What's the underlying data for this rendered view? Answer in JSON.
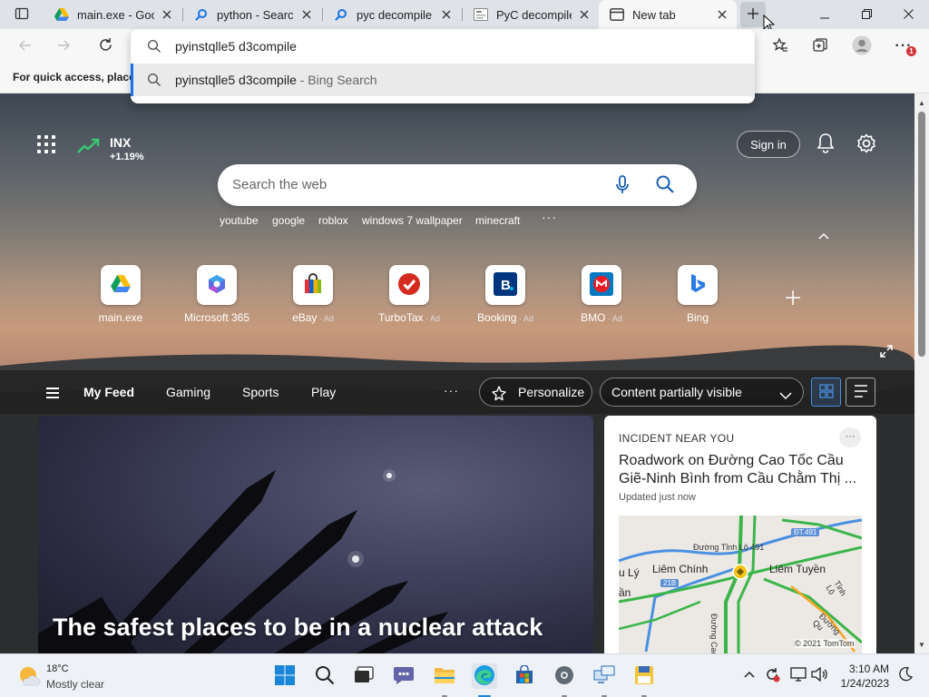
{
  "tabs": [
    {
      "title": "main.exe - Goog",
      "icon": "google-drive-icon"
    },
    {
      "title": "python - Search",
      "icon": "search-icon"
    },
    {
      "title": "pyc decompile o",
      "icon": "search-icon"
    },
    {
      "title": "PyC decompile",
      "icon": "page-icon"
    },
    {
      "title": "New tab",
      "icon": "newtab-icon"
    }
  ],
  "omnibox": {
    "value": "pyinstqlle5 d3compile",
    "suggestion_query": "pyinstqlle5 d3compile",
    "suggestion_suffix": " - Bing Search"
  },
  "favorites_bar": {
    "text": "For quick access, place y"
  },
  "stock": {
    "name": "INX",
    "change": "+1.19%"
  },
  "header": {
    "signin": "Sign in"
  },
  "search": {
    "placeholder": "Search the web"
  },
  "trending": [
    "youtube",
    "google",
    "roblox",
    "windows 7 wallpaper",
    "minecraft"
  ],
  "tiles": [
    {
      "label": "main.exe",
      "ad": ""
    },
    {
      "label": "Microsoft 365",
      "ad": ""
    },
    {
      "label": "eBay",
      "ad": " · Ad"
    },
    {
      "label": "TurboTax",
      "ad": " · Ad"
    },
    {
      "label": "Booking",
      "ad": " · Ad"
    },
    {
      "label": "BMO",
      "ad": " · Ad"
    },
    {
      "label": "Bing",
      "ad": ""
    }
  ],
  "feed_nav": {
    "items": [
      "My Feed",
      "Gaming",
      "Sports",
      "Play"
    ],
    "more": "···",
    "personalize": "Personalize",
    "content_visibility": "Content partially visible"
  },
  "main_card": {
    "headline": "The safest places to be in a nuclear attack"
  },
  "incident_card": {
    "kicker": "INCIDENT NEAR YOU",
    "more": "···",
    "title": "Roadwork on Đường Cao Tốc Cầu Giẽ-Ninh Bình from Cầu Chằm Thị ...",
    "updated": "Updated just now",
    "map_labels": {
      "dt491": "ĐT.491",
      "road_tinh": "Đường Tỉnh Lộ 491",
      "ly": "u Lý",
      "an": "ần",
      "liem_chinh": "Liêm Chính",
      "liem_tuyen": "Liêm Tuyền",
      "r21b": "21B",
      "duong_cao": "Đường Cao",
      "tinh_lo": "Tỉnh Lộ",
      "duong_qu": "Đường Qu",
      "copyright": "© 2021 TomTom"
    }
  },
  "taskbar": {
    "temp": "18°C",
    "condition": "Mostly clear",
    "time": "3:10 AM",
    "date": "1/24/2023",
    "profile_badge": "1"
  }
}
